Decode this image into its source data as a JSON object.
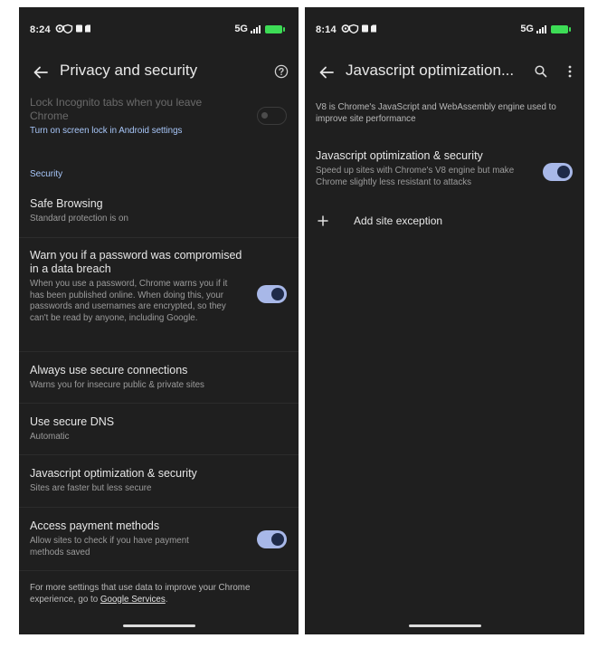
{
  "left": {
    "status": {
      "time": "8:24",
      "network": "5G"
    },
    "app_bar": {
      "title": "Privacy and security"
    },
    "incognito": {
      "title": "Lock Incognito tabs when you leave Chrome",
      "link": "Turn on screen lock in Android settings",
      "toggle_on": false
    },
    "security_header": "Security",
    "items": [
      {
        "title": "Safe Browsing",
        "subtitle": "Standard protection is on"
      },
      {
        "title": "Warn you if a password was compromised in a data breach",
        "subtitle": "When you use a password, Chrome warns you if it has been published online. When doing this, your passwords and usernames are encrypted, so they can't be read by anyone, including Google.",
        "toggle_on": true
      },
      {
        "title": "Always use secure connections",
        "subtitle": "Warns you for insecure public & private sites"
      },
      {
        "title": "Use secure DNS",
        "subtitle": "Automatic"
      },
      {
        "title": "Javascript optimization & security",
        "subtitle": "Sites are faster but less secure"
      },
      {
        "title": "Access payment methods",
        "subtitle": "Allow sites to check if you have payment methods saved",
        "toggle_on": true
      }
    ],
    "footer": {
      "text": "For more settings that use data to improve your Chrome experience, go to ",
      "link": "Google Services",
      "end": "."
    }
  },
  "right": {
    "status": {
      "time": "8:14",
      "network": "5G"
    },
    "app_bar": {
      "title": "Javascript optimization..."
    },
    "description": "V8 is Chrome's JavaScript and WebAssembly engine used to improve site performance",
    "setting": {
      "title": "Javascript optimization & security",
      "subtitle": "Speed up sites with Chrome's V8 engine but make Chrome slightly less resistant to attacks",
      "toggle_on": true
    },
    "add_exception": "Add site exception"
  },
  "colors": {
    "background": "#1f1f1f",
    "accent_link": "#a8c7fa",
    "toggle_track": "#a8b8e8",
    "battery": "#3ddc56"
  },
  "icons": [
    "back-arrow-icon",
    "help-icon",
    "search-icon",
    "more-vert-icon",
    "plus-icon",
    "gear-icon",
    "shield-icon",
    "sim-icon",
    "battery-icon"
  ]
}
